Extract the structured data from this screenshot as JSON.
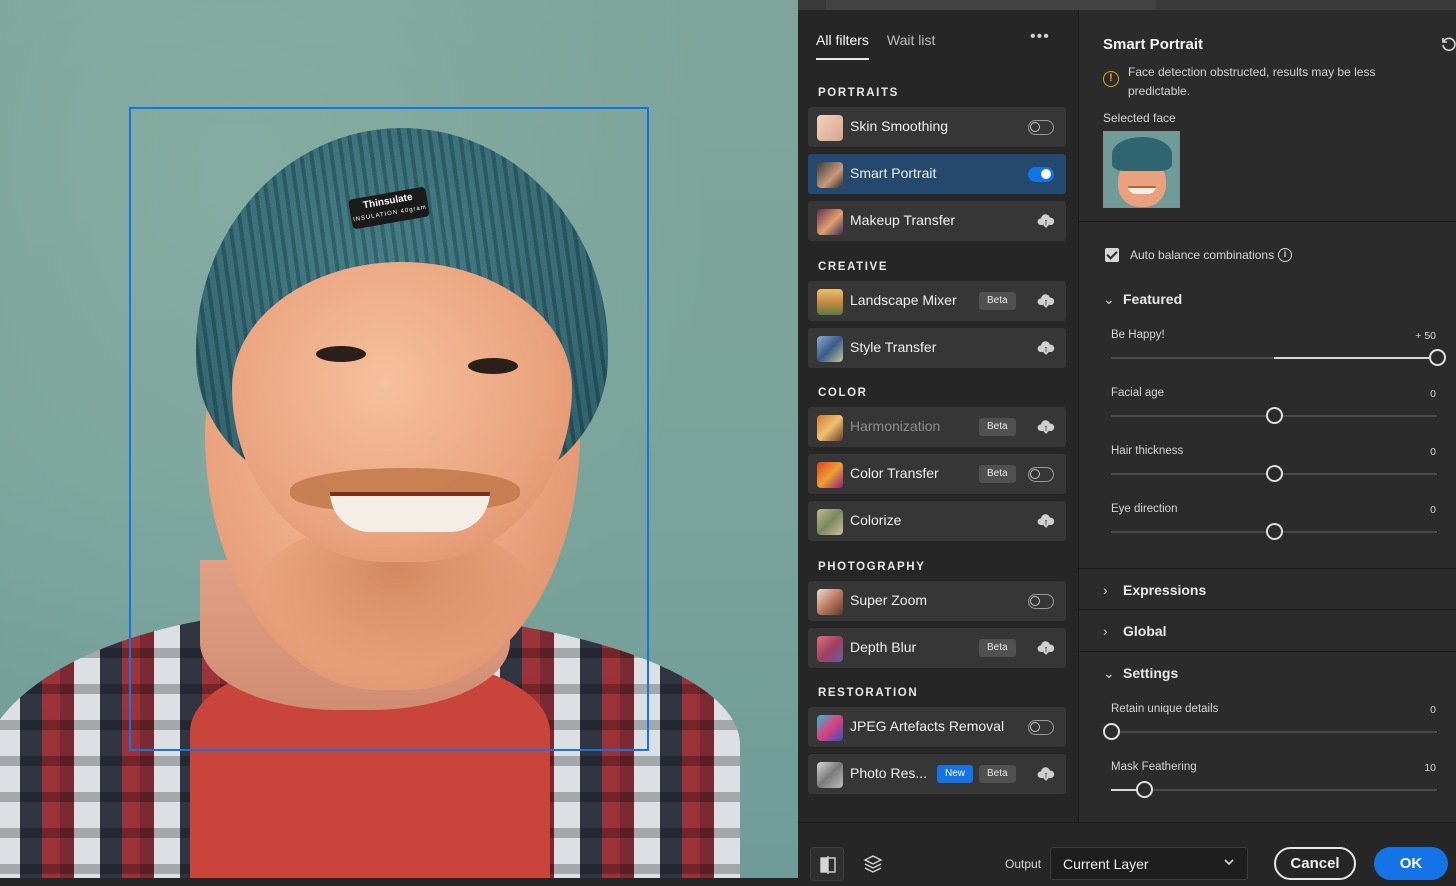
{
  "canvas": {
    "hat_label": "Thinsulate",
    "hat_label_sub": "INSULATION 40gram"
  },
  "filters_panel": {
    "tabs": [
      {
        "label": "All filters",
        "active": true
      },
      {
        "label": "Wait list",
        "active": false
      }
    ],
    "more_label": "•••",
    "categories": {
      "portraits": "PORTRAITS",
      "creative": "CREATIVE",
      "color": "COLOR",
      "photography": "PHOTOGRAPHY",
      "restoration": "RESTORATION"
    },
    "items": {
      "skin_smoothing": {
        "name": "Skin Smoothing",
        "control": "toggle",
        "state": "off"
      },
      "smart_portrait": {
        "name": "Smart Portrait",
        "control": "toggle",
        "state": "on",
        "selected": true
      },
      "makeup_transfer": {
        "name": "Makeup Transfer",
        "control": "cloud-download-icon"
      },
      "landscape_mixer": {
        "name": "Landscape Mixer",
        "badge": "Beta",
        "control": "cloud-download-icon"
      },
      "style_transfer": {
        "name": "Style Transfer",
        "control": "cloud-download-icon"
      },
      "harmonization": {
        "name": "Harmonization",
        "badge": "Beta",
        "control": "cloud-download-icon",
        "disabled": true
      },
      "color_transfer": {
        "name": "Color Transfer",
        "badge": "Beta",
        "control": "toggle",
        "state": "off"
      },
      "colorize": {
        "name": "Colorize",
        "control": "cloud-download-icon"
      },
      "super_zoom": {
        "name": "Super Zoom",
        "control": "toggle",
        "state": "off"
      },
      "depth_blur": {
        "name": "Depth Blur",
        "badge": "Beta",
        "control": "cloud-download-icon"
      },
      "jpeg_artefacts": {
        "name": "JPEG Artefacts Removal",
        "control": "toggle",
        "state": "off"
      },
      "photo_restoration": {
        "name": "Photo Res...",
        "badge_new": "New",
        "badge": "Beta",
        "control": "cloud-download-icon"
      }
    }
  },
  "properties": {
    "title": "Smart Portrait",
    "warning": "Face detection obstructed, results may be less predictable.",
    "selected_face_label": "Selected face",
    "auto_balance_label": "Auto balance combinations",
    "auto_balance_checked": true,
    "sections": {
      "featured": {
        "label": "Featured",
        "expanded": true
      },
      "expressions": {
        "label": "Expressions",
        "expanded": false
      },
      "global": {
        "label": "Global",
        "expanded": false
      },
      "settings": {
        "label": "Settings",
        "expanded": true
      }
    },
    "sliders": {
      "be_happy": {
        "label": "Be Happy!",
        "value_text": "+ 50",
        "value": 50,
        "min": -50,
        "max": 50
      },
      "facial_age": {
        "label": "Facial age",
        "value_text": "0",
        "value": 0,
        "min": -50,
        "max": 50
      },
      "hair_thickness": {
        "label": "Hair thickness",
        "value_text": "0",
        "value": 0,
        "min": -50,
        "max": 50
      },
      "eye_direction": {
        "label": "Eye direction",
        "value_text": "0",
        "value": 0,
        "min": -50,
        "max": 50
      },
      "retain_details": {
        "label": "Retain unique details",
        "value_text": "0",
        "value": 0,
        "min": 0,
        "max": 100
      },
      "mask_feathering": {
        "label": "Mask Feathering",
        "value_text": "10",
        "value": 10,
        "min": 0,
        "max": 100
      }
    }
  },
  "bottom_bar": {
    "output_label": "Output",
    "output_value": "Current Layer",
    "cancel_label": "Cancel",
    "ok_label": "OK"
  },
  "colors": {
    "accent": "#1473e6",
    "selected_row": "#25486e",
    "warning": "#e8a317"
  }
}
